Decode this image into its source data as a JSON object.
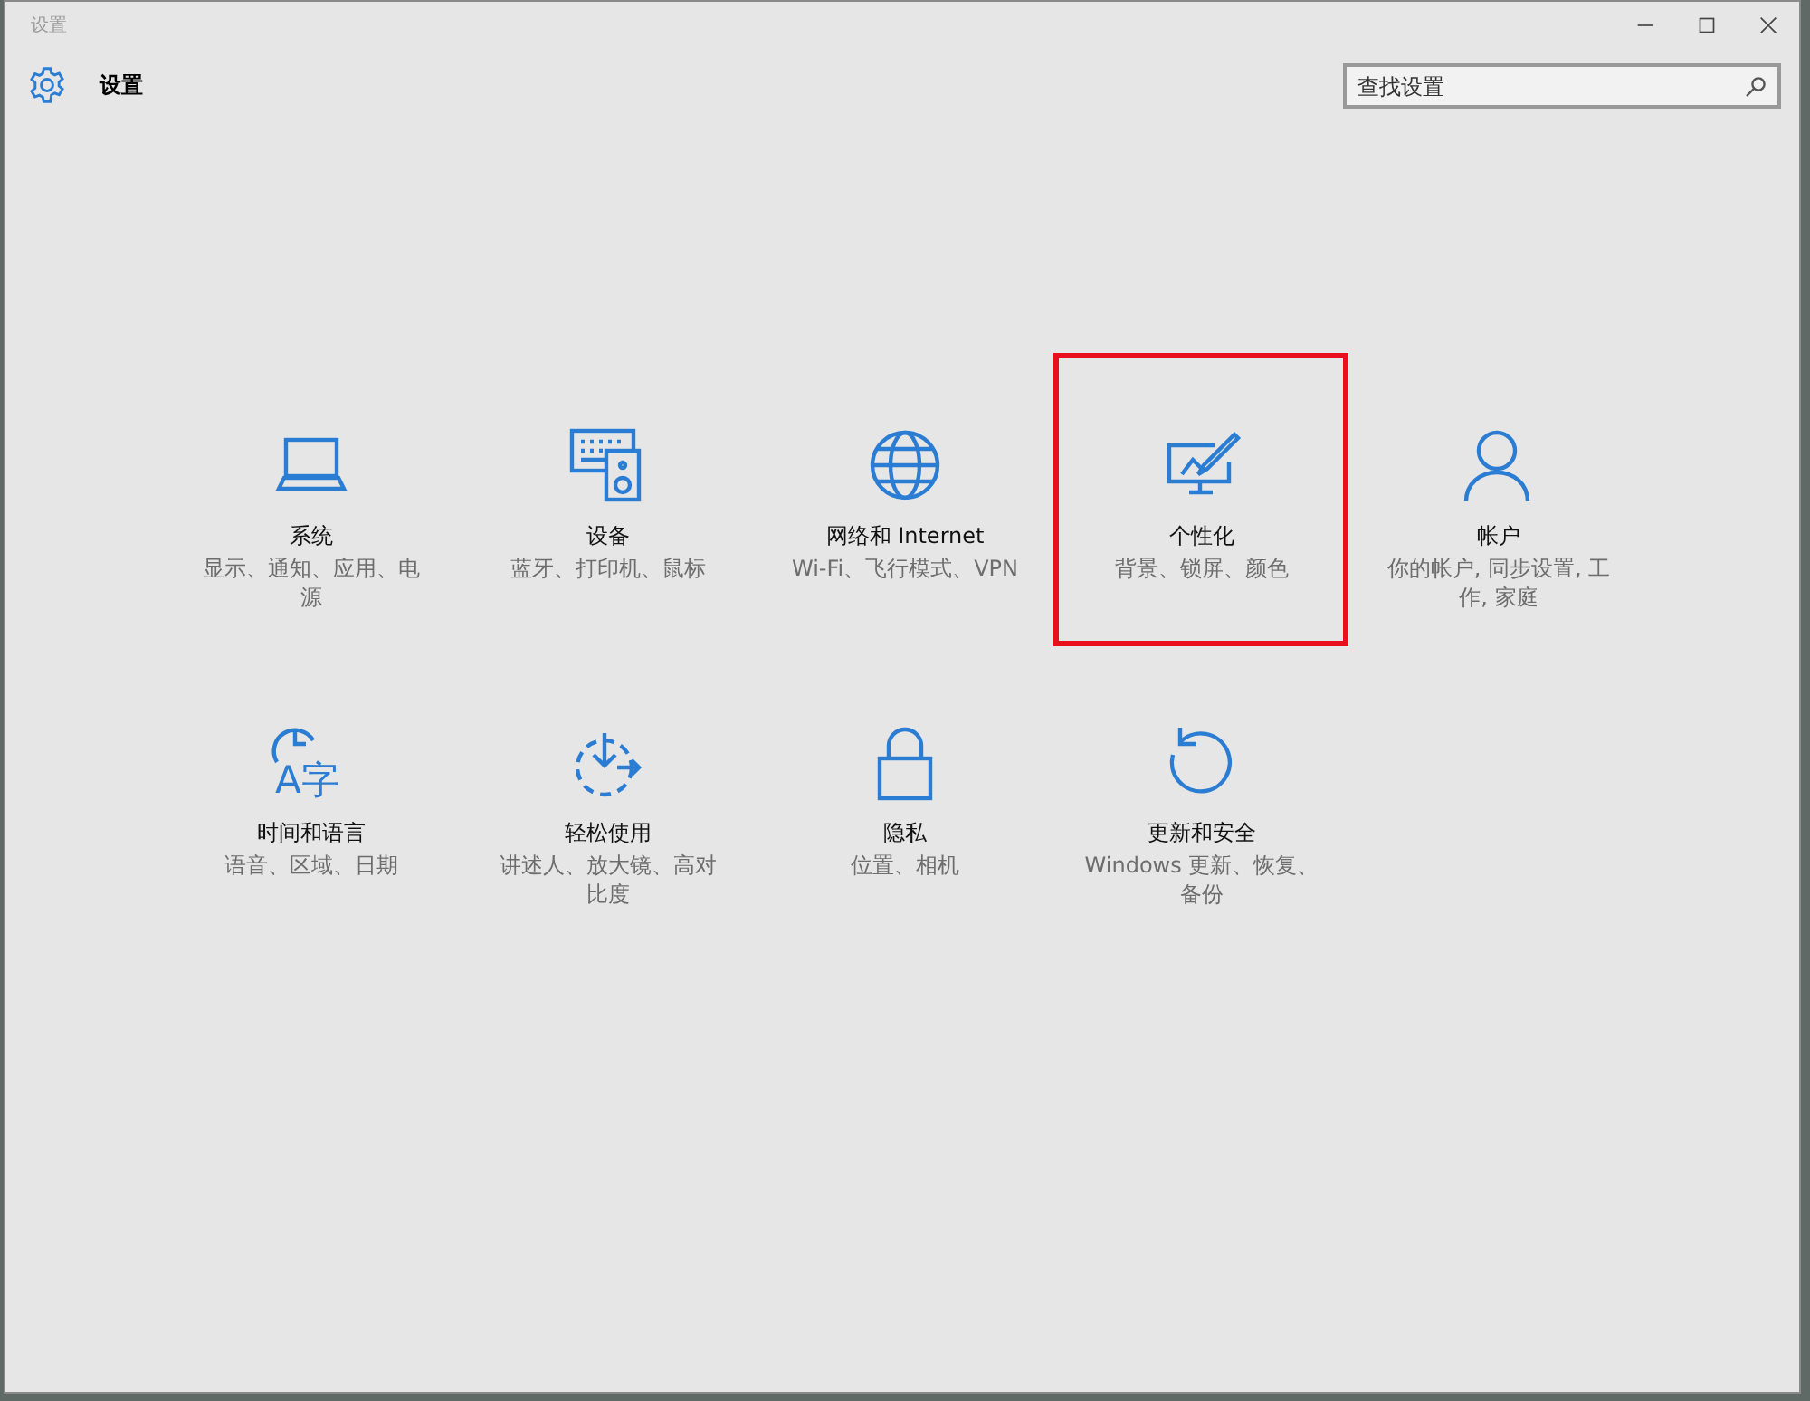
{
  "window": {
    "title": "设置"
  },
  "header": {
    "title": "设置"
  },
  "search": {
    "placeholder": "查找设置"
  },
  "tiles": [
    {
      "kind": "system",
      "title": "系统",
      "subtitle": "显示、通知、应用、电源",
      "highlighted": false
    },
    {
      "kind": "devices",
      "title": "设备",
      "subtitle": "蓝牙、打印机、鼠标",
      "highlighted": false
    },
    {
      "kind": "network",
      "title": "网络和 Internet",
      "subtitle": "Wi-Fi、飞行模式、VPN",
      "highlighted": false
    },
    {
      "kind": "personalization",
      "title": "个性化",
      "subtitle": "背景、锁屏、颜色",
      "highlighted": true
    },
    {
      "kind": "accounts",
      "title": "帐户",
      "subtitle": "你的帐户, 同步设置, 工作, 家庭",
      "highlighted": false
    },
    {
      "kind": "time",
      "title": "时间和语言",
      "subtitle": "语音、区域、日期",
      "glyph": "A字",
      "highlighted": false
    },
    {
      "kind": "ease",
      "title": "轻松使用",
      "subtitle": "讲述人、放大镜、高对比度",
      "highlighted": false
    },
    {
      "kind": "privacy",
      "title": "隐私",
      "subtitle": "位置、相机",
      "highlighted": false
    },
    {
      "kind": "update",
      "title": "更新和安全",
      "subtitle": "Windows 更新、恢复、备份",
      "highlighted": false
    }
  ]
}
